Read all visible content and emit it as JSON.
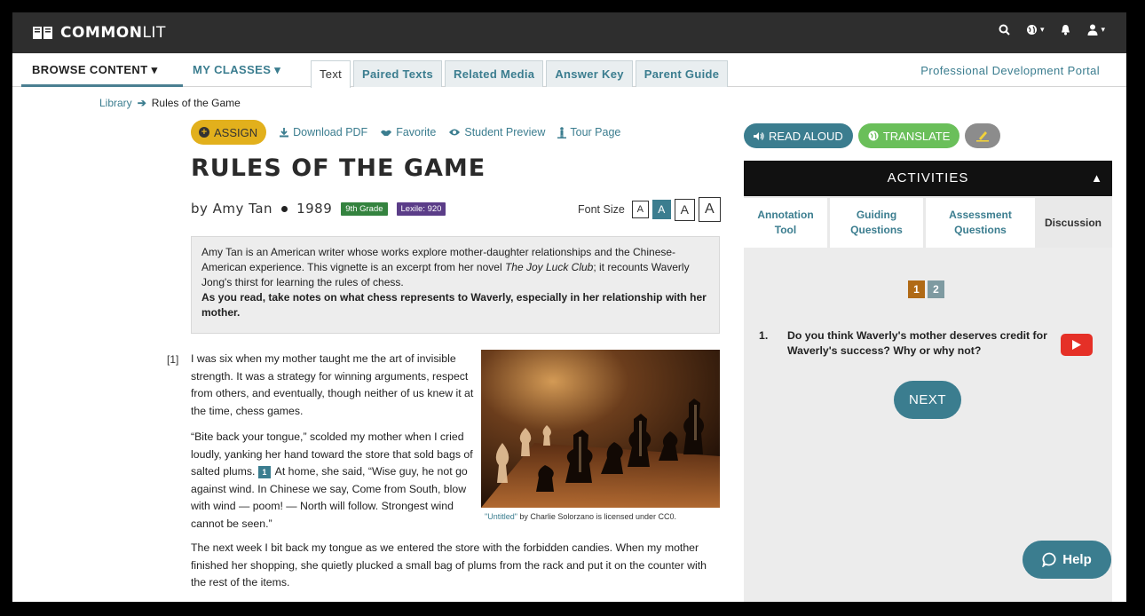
{
  "brand": {
    "name_bold": "COMMON",
    "name_light": "LIT"
  },
  "nav": {
    "browse": "BROWSE CONTENT",
    "my_classes": "MY CLASSES",
    "tabs": [
      "Text",
      "Paired Texts",
      "Related Media",
      "Answer Key",
      "Parent Guide"
    ],
    "pd_portal": "Professional Development Portal"
  },
  "breadcrumb": {
    "library": "Library",
    "current": "Rules of the Game"
  },
  "actions": {
    "assign": "ASSIGN",
    "download_pdf": "Download PDF",
    "favorite": "Favorite",
    "student_preview": "Student Preview",
    "tour_page": "Tour Page"
  },
  "text": {
    "title": "RULES OF THE GAME",
    "author": "by Amy Tan",
    "year": "1989",
    "grade": "9th Grade",
    "lexile": "Lexile: 920",
    "font_size_label": "Font Size",
    "font_size_letter": "A",
    "intro_1": "Amy Tan is an American writer whose works explore mother-daughter relationships and the Chinese-American experience. This vignette is an excerpt from her novel ",
    "intro_book": "The Joy Luck Club",
    "intro_2": "; it recounts Waverly Jong's thirst for learning the rules of chess.",
    "intro_bold": "As you read, take notes on what chess represents to Waverly, especially in her relationship with her mother.",
    "para_num": "[1]",
    "p1": "I was six when my mother taught me the art of invisible strength. It was a strategy for winning arguments, respect from others, and eventually, though neither of us knew it at the time, chess games.",
    "p2_a": "“Bite back your tongue,” scolded my mother when I cried loudly, yanking her hand toward the store that sold bags of salted plums. ",
    "p2_anno": "1",
    "p2_b": " At home, she said, “Wise guy, he not go against wind. In Chinese we say, Come from South, blow with wind — poom! — North will follow. Strongest wind cannot be seen.”",
    "p3": "The next week I bit back my tongue as we entered the store with the forbidden candies. When my mother finished her shopping, she quietly plucked a small bag of plums from the rack and put it on the counter with the rest of the items.",
    "caption_link": "\"Untitled\"",
    "caption_rest": " by Charlie Solorzano is licensed under CC0."
  },
  "panel": {
    "read_aloud": "READ ALOUD",
    "translate": "TRANSLATE",
    "activities": "ACTIVITIES",
    "tabs": [
      {
        "line1": "Annotation",
        "line2": "Tool"
      },
      {
        "line1": "Guiding",
        "line2": "Questions"
      },
      {
        "line1": "Assessment",
        "line2": "Questions"
      },
      {
        "line1": "Discussion",
        "line2": ""
      }
    ],
    "pages": [
      "1",
      "2"
    ],
    "question_num": "1.",
    "question": "Do you think Waverly's mother deserves credit for Waverly's success? Why or why not?",
    "next": "NEXT",
    "help": "Help"
  },
  "colors": {
    "teal": "#3b7d8f",
    "assign_yellow": "#e2b01c",
    "grade_green": "#34833f",
    "lexile_purple": "#5b3d88",
    "translate_green": "#6abf5a",
    "page_active": "#b06a16"
  }
}
